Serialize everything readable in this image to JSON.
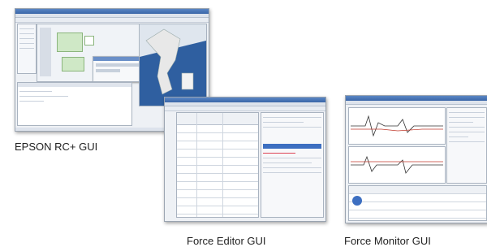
{
  "captions": {
    "epson": "EPSON RC+ GUI",
    "force_editor": "Force Editor GUI",
    "force_monitor": "Force Monitor GUI"
  },
  "colors": {
    "titlebar": "#3a66a8",
    "robot_bg": "#2f5fa0",
    "robot_arm": "#e8e8e8",
    "trace_red": "#c0392b",
    "trace_dark": "#333333",
    "selection": "#3d6fc1"
  }
}
